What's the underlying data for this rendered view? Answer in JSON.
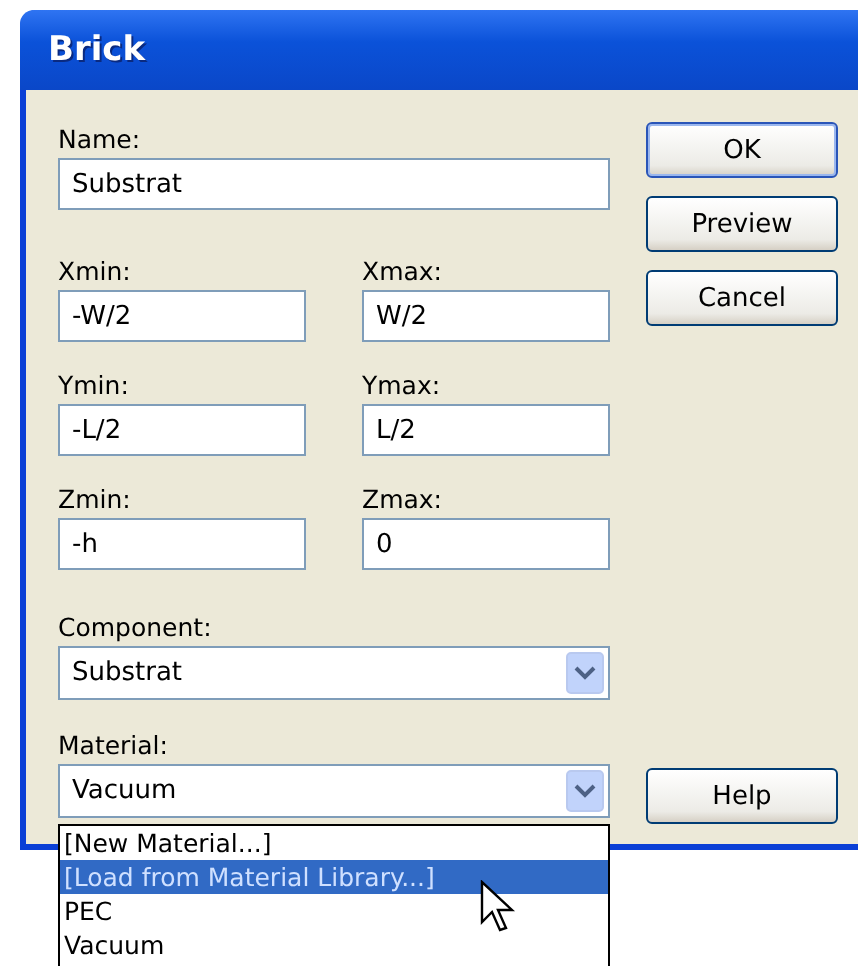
{
  "window": {
    "title": "Brick"
  },
  "name": {
    "label": "Name:",
    "value": "Substrat"
  },
  "ranges": [
    {
      "min_label": "Xmin:",
      "min_value": "-W/2",
      "max_label": "Xmax:",
      "max_value": "W/2"
    },
    {
      "min_label": "Ymin:",
      "min_value": "-L/2",
      "max_label": "Ymax:",
      "max_value": "L/2"
    },
    {
      "min_label": "Zmin:",
      "min_value": "-h",
      "max_label": "Zmax:",
      "max_value": "0"
    }
  ],
  "component": {
    "label": "Component:",
    "value": "Substrat"
  },
  "material": {
    "label": "Material:",
    "value": "Vacuum",
    "expanded": true,
    "options": [
      {
        "label": "[New Material...]",
        "highlighted": false
      },
      {
        "label": "[Load from Material Library...]",
        "highlighted": true
      },
      {
        "label": "PEC",
        "highlighted": false
      },
      {
        "label": "Vacuum",
        "highlighted": false
      }
    ]
  },
  "buttons": [
    {
      "label": "OK",
      "kind": "default"
    },
    {
      "label": "Preview",
      "kind": "normal"
    },
    {
      "label": "Cancel",
      "kind": "normal"
    }
  ],
  "help_button": {
    "label": "Help"
  }
}
